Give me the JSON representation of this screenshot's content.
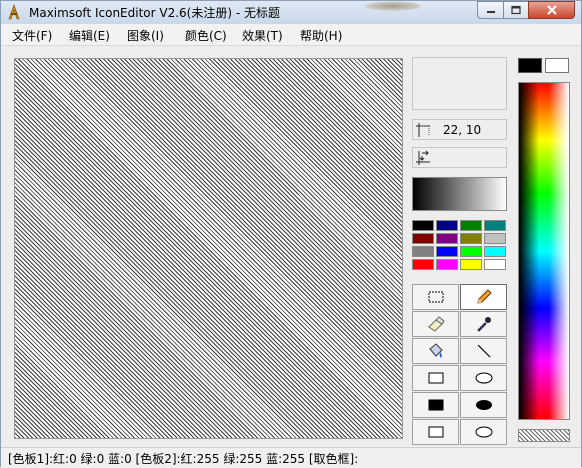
{
  "window": {
    "title": "Maximsoft IconEditor V2.6(未注册) - 无标题",
    "app_icon": "iconeditor-logo-icon",
    "controls": [
      "minimize-icon",
      "maximize-icon",
      "close-icon"
    ]
  },
  "menu": [
    {
      "label": "文件(F)"
    },
    {
      "label": "编辑(E)"
    },
    {
      "label": "图象(I)"
    },
    {
      "label": "颜色(C)"
    },
    {
      "label": "效果(T)"
    },
    {
      "label": "帮助(H)"
    }
  ],
  "info": {
    "coords": "22, 10",
    "size": ""
  },
  "palette": {
    "colors": [
      [
        "#000000",
        "#000080",
        "#008000",
        "#008080"
      ],
      [
        "#800000",
        "#800080",
        "#808000",
        "#c0c0c0"
      ],
      [
        "#808080",
        "#0000ff",
        "#00ff00",
        "#00ffff"
      ],
      [
        "#ff0000",
        "#ff00ff",
        "#ffff00",
        "#ffffff"
      ]
    ],
    "primary": "#000000",
    "secondary": "#ffffff"
  },
  "tools": [
    {
      "name": "select-rect-icon",
      "active": false
    },
    {
      "name": "pencil-icon",
      "active": true
    },
    {
      "name": "eraser-icon",
      "active": false
    },
    {
      "name": "eyedropper-icon",
      "active": false
    },
    {
      "name": "paint-bucket-icon",
      "active": false
    },
    {
      "name": "line-icon",
      "active": false
    },
    {
      "name": "rectangle-outline-icon",
      "active": false
    },
    {
      "name": "ellipse-outline-icon",
      "active": false
    },
    {
      "name": "rectangle-filled-icon",
      "active": false
    },
    {
      "name": "ellipse-filled-icon",
      "active": false
    },
    {
      "name": "rounded-rectangle-icon",
      "active": false
    },
    {
      "name": "ellipse-icon",
      "active": false
    }
  ],
  "status": {
    "text": "[色板1]:红:0 绿:0 蓝:0  [色板2]:红:255 绿:255 蓝:255  [取色框]:"
  }
}
